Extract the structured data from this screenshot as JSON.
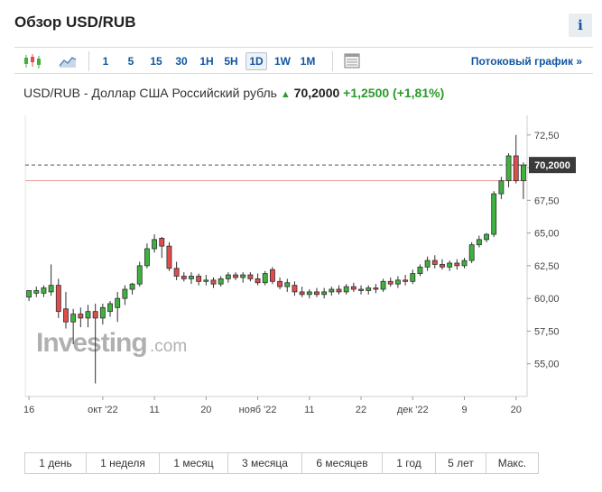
{
  "header": {
    "title": "Обзор USD/RUB",
    "info_label": "i"
  },
  "toolbar": {
    "intervals": [
      "1",
      "5",
      "15",
      "30",
      "1H",
      "5H",
      "1D",
      "1W",
      "1M"
    ],
    "active_interval": "1D",
    "stream_label": "Потоковый график »",
    "candle_icon": "candlestick-icon",
    "area_icon": "area-chart-icon",
    "table_icon": "data-table-icon"
  },
  "quote": {
    "name": "USD/RUB - Доллар США Российский рубль",
    "price": "70,2000",
    "change": "+1,2500",
    "change_pct": "(+1,81%)",
    "direction_icon": "up-arrow-icon",
    "up_color": "#2a9b2a"
  },
  "watermark": {
    "brand": "Investing",
    "suffix": ".com"
  },
  "chart_data": {
    "type": "candlestick",
    "pair": "USD/RUB",
    "ylim": [
      52.5,
      74
    ],
    "yticks": [
      55,
      57.5,
      60,
      62.5,
      65,
      67.5,
      70,
      72.5
    ],
    "ytick_labels": [
      "55,00",
      "57,50",
      "60,00",
      "62,50",
      "65,00",
      "67,50",
      "70,00",
      "72,50"
    ],
    "current_price": 70.2,
    "current_label": "70,2000",
    "reference_price": 69.0,
    "xtick_labels": [
      {
        "i": 0,
        "label": "16"
      },
      {
        "i": 10,
        "label": "окт '22"
      },
      {
        "i": 17,
        "label": "11"
      },
      {
        "i": 24,
        "label": "20"
      },
      {
        "i": 31,
        "label": "нояб '22"
      },
      {
        "i": 38,
        "label": "11"
      },
      {
        "i": 45,
        "label": "22"
      },
      {
        "i": 52,
        "label": "дек '22"
      },
      {
        "i": 59,
        "label": "9"
      },
      {
        "i": 66,
        "label": "20"
      }
    ],
    "candles": [
      {
        "o": 60.1,
        "h": 60.6,
        "l": 59.8,
        "c": 60.6
      },
      {
        "o": 60.4,
        "h": 60.9,
        "l": 60.1,
        "c": 60.6
      },
      {
        "o": 60.4,
        "h": 61.0,
        "l": 60.1,
        "c": 60.8
      },
      {
        "o": 60.5,
        "h": 62.6,
        "l": 60.2,
        "c": 61.0
      },
      {
        "o": 61.0,
        "h": 61.5,
        "l": 58.5,
        "c": 59.0
      },
      {
        "o": 59.2,
        "h": 60.5,
        "l": 57.7,
        "c": 58.2
      },
      {
        "o": 58.2,
        "h": 59.2,
        "l": 56.5,
        "c": 58.8
      },
      {
        "o": 58.8,
        "h": 59.3,
        "l": 57.8,
        "c": 58.5
      },
      {
        "o": 58.5,
        "h": 59.5,
        "l": 57.8,
        "c": 59.0
      },
      {
        "o": 59.0,
        "h": 59.6,
        "l": 53.5,
        "c": 58.5
      },
      {
        "o": 58.5,
        "h": 59.6,
        "l": 58.0,
        "c": 59.3
      },
      {
        "o": 59.0,
        "h": 59.8,
        "l": 58.6,
        "c": 59.6
      },
      {
        "o": 59.3,
        "h": 60.5,
        "l": 58.2,
        "c": 60.0
      },
      {
        "o": 60.0,
        "h": 61.0,
        "l": 59.5,
        "c": 60.7
      },
      {
        "o": 60.7,
        "h": 61.2,
        "l": 60.3,
        "c": 61.1
      },
      {
        "o": 61.1,
        "h": 62.8,
        "l": 60.9,
        "c": 62.5
      },
      {
        "o": 62.5,
        "h": 64.2,
        "l": 62.3,
        "c": 63.8
      },
      {
        "o": 63.8,
        "h": 64.9,
        "l": 63.5,
        "c": 64.5
      },
      {
        "o": 64.6,
        "h": 64.7,
        "l": 63.1,
        "c": 64.0
      },
      {
        "o": 64.0,
        "h": 64.3,
        "l": 62.1,
        "c": 62.3
      },
      {
        "o": 62.3,
        "h": 62.8,
        "l": 61.4,
        "c": 61.7
      },
      {
        "o": 61.7,
        "h": 62.0,
        "l": 61.3,
        "c": 61.5
      },
      {
        "o": 61.5,
        "h": 62.0,
        "l": 61.1,
        "c": 61.7
      },
      {
        "o": 61.7,
        "h": 61.9,
        "l": 61.0,
        "c": 61.3
      },
      {
        "o": 61.3,
        "h": 61.8,
        "l": 61.0,
        "c": 61.4
      },
      {
        "o": 61.4,
        "h": 61.6,
        "l": 60.8,
        "c": 61.1
      },
      {
        "o": 61.1,
        "h": 61.7,
        "l": 60.9,
        "c": 61.5
      },
      {
        "o": 61.5,
        "h": 62.0,
        "l": 61.2,
        "c": 61.8
      },
      {
        "o": 61.8,
        "h": 62.0,
        "l": 61.4,
        "c": 61.6
      },
      {
        "o": 61.6,
        "h": 62.0,
        "l": 61.2,
        "c": 61.8
      },
      {
        "o": 61.8,
        "h": 62.0,
        "l": 61.3,
        "c": 61.5
      },
      {
        "o": 61.5,
        "h": 61.9,
        "l": 61.0,
        "c": 61.2
      },
      {
        "o": 61.2,
        "h": 62.1,
        "l": 61.0,
        "c": 61.9
      },
      {
        "o": 62.2,
        "h": 62.4,
        "l": 61.1,
        "c": 61.3
      },
      {
        "o": 61.3,
        "h": 61.6,
        "l": 60.7,
        "c": 60.9
      },
      {
        "o": 60.9,
        "h": 61.5,
        "l": 60.5,
        "c": 61.2
      },
      {
        "o": 61.0,
        "h": 61.3,
        "l": 60.2,
        "c": 60.5
      },
      {
        "o": 60.5,
        "h": 60.9,
        "l": 60.1,
        "c": 60.3
      },
      {
        "o": 60.3,
        "h": 60.7,
        "l": 60.0,
        "c": 60.5
      },
      {
        "o": 60.5,
        "h": 60.8,
        "l": 60.1,
        "c": 60.3
      },
      {
        "o": 60.3,
        "h": 60.8,
        "l": 60.0,
        "c": 60.5
      },
      {
        "o": 60.5,
        "h": 60.9,
        "l": 60.2,
        "c": 60.7
      },
      {
        "o": 60.7,
        "h": 61.0,
        "l": 60.3,
        "c": 60.5
      },
      {
        "o": 60.5,
        "h": 61.1,
        "l": 60.3,
        "c": 60.9
      },
      {
        "o": 60.9,
        "h": 61.2,
        "l": 60.5,
        "c": 60.7
      },
      {
        "o": 60.7,
        "h": 61.0,
        "l": 60.3,
        "c": 60.6
      },
      {
        "o": 60.6,
        "h": 61.0,
        "l": 60.3,
        "c": 60.8
      },
      {
        "o": 60.8,
        "h": 61.1,
        "l": 60.4,
        "c": 60.7
      },
      {
        "o": 60.7,
        "h": 61.5,
        "l": 60.5,
        "c": 61.3
      },
      {
        "o": 61.3,
        "h": 61.6,
        "l": 60.9,
        "c": 61.1
      },
      {
        "o": 61.1,
        "h": 61.7,
        "l": 60.8,
        "c": 61.4
      },
      {
        "o": 61.4,
        "h": 61.8,
        "l": 61.0,
        "c": 61.3
      },
      {
        "o": 61.3,
        "h": 62.2,
        "l": 61.1,
        "c": 61.9
      },
      {
        "o": 61.9,
        "h": 62.6,
        "l": 61.7,
        "c": 62.4
      },
      {
        "o": 62.4,
        "h": 63.2,
        "l": 62.1,
        "c": 62.9
      },
      {
        "o": 62.9,
        "h": 63.3,
        "l": 62.3,
        "c": 62.6
      },
      {
        "o": 62.6,
        "h": 63.0,
        "l": 62.2,
        "c": 62.4
      },
      {
        "o": 62.4,
        "h": 62.9,
        "l": 62.1,
        "c": 62.7
      },
      {
        "o": 62.7,
        "h": 63.0,
        "l": 62.2,
        "c": 62.5
      },
      {
        "o": 62.5,
        "h": 63.1,
        "l": 62.3,
        "c": 62.9
      },
      {
        "o": 62.9,
        "h": 64.3,
        "l": 62.7,
        "c": 64.1
      },
      {
        "o": 64.1,
        "h": 64.8,
        "l": 63.9,
        "c": 64.5
      },
      {
        "o": 64.5,
        "h": 65.0,
        "l": 64.3,
        "c": 64.9
      },
      {
        "o": 64.9,
        "h": 68.2,
        "l": 64.7,
        "c": 68.0
      },
      {
        "o": 68.0,
        "h": 69.3,
        "l": 67.6,
        "c": 69.0
      },
      {
        "o": 69.0,
        "h": 71.1,
        "l": 68.5,
        "c": 70.9
      },
      {
        "o": 70.9,
        "h": 72.5,
        "l": 68.8,
        "c": 69.0
      },
      {
        "o": 69.0,
        "h": 70.4,
        "l": 67.6,
        "c": 70.2
      }
    ],
    "up_color": "#3fb13f",
    "down_color": "#e24c4c"
  },
  "ranges": [
    "1 день",
    "1 неделя",
    "1 месяц",
    "3 месяца",
    "6 месяцев",
    "1 год",
    "5 лет",
    "Макс."
  ],
  "ranges_active": "Макс."
}
